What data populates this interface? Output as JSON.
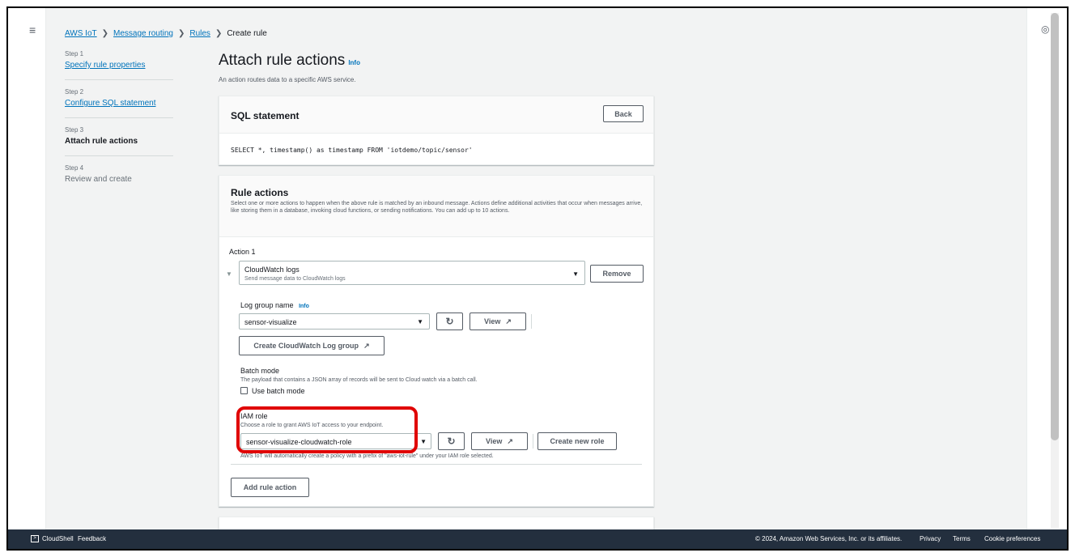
{
  "breadcrumb": [
    "AWS IoT",
    "Message routing",
    "Rules",
    "Create rule"
  ],
  "steps": [
    {
      "num": "Step 1",
      "label": "Specify rule properties"
    },
    {
      "num": "Step 2",
      "label": "Configure SQL statement"
    },
    {
      "num": "Step 3",
      "label": "Attach rule actions"
    },
    {
      "num": "Step 4",
      "label": "Review and create"
    }
  ],
  "page": {
    "title": "Attach rule actions",
    "info": "Info",
    "description": "An action routes data to a specific AWS service."
  },
  "sql": {
    "title": "SQL statement",
    "back": "Back",
    "statement": "SELECT *, timestamp() as timestamp FROM 'iotdemo/topic/sensor'"
  },
  "rule_actions": {
    "title": "Rule actions",
    "description": "Select one or more actions to happen when the above rule is matched by an inbound message. Actions define additional activities that occur when messages arrive, like storing them in a database, invoking cloud functions, or sending notifications. You can add up to 10 actions.",
    "action_label": "Action 1",
    "action_name": "CloudWatch logs",
    "action_desc": "Send message data to CloudWatch logs",
    "remove": "Remove",
    "log_group_label": "Log group name",
    "log_group_info": "Info",
    "log_group_value": "sensor-visualize",
    "view": "View",
    "create_log_group": "Create CloudWatch Log group",
    "batch_label": "Batch mode",
    "batch_desc": "The payload that contains a JSON array of records will be sent to Cloud watch via a batch call.",
    "batch_checkbox": "Use batch mode",
    "iam_label": "IAM role",
    "iam_desc": "Choose a role to grant AWS IoT access to your endpoint.",
    "iam_value": "sensor-visualize-cloudwatch-role",
    "iam_view": "View",
    "create_role": "Create new role",
    "iam_note": "AWS IoT will automatically create a policy with a prefix of \"aws-iot-rule\" under your IAM role selected.",
    "add_action": "Add rule action"
  },
  "footer": {
    "cloudshell": "CloudShell",
    "feedback": "Feedback",
    "copyright": "© 2024, Amazon Web Services, Inc. or its affiliates.",
    "privacy": "Privacy",
    "terms": "Terms",
    "cookies": "Cookie preferences"
  },
  "colors": {
    "link": "#0073bb",
    "highlight": "#e00000",
    "footer_bg": "#232f3e"
  }
}
